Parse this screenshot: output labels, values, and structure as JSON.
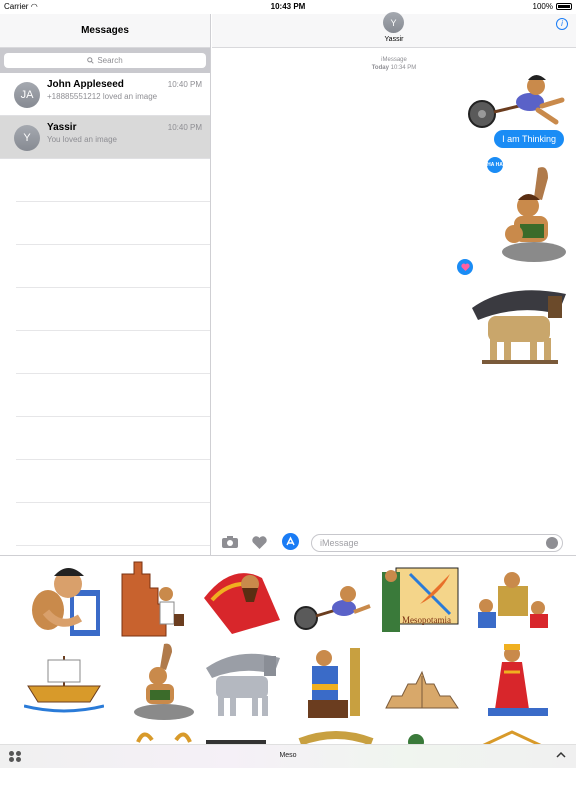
{
  "status_bar": {
    "carrier": "Carrier",
    "time": "10:43 PM",
    "battery": "100%"
  },
  "sidebar": {
    "title": "Messages",
    "search_placeholder": "Search",
    "conversations": [
      {
        "initials": "JA",
        "name": "John Appleseed",
        "time": "10:40 PM",
        "snippet": "+18885551212 loved an image"
      },
      {
        "initials": "Y",
        "name": "Yassir",
        "time": "10:40 PM",
        "snippet": "You loved an image"
      }
    ]
  },
  "chat": {
    "contact_initial": "Y",
    "contact_name": "Yassir",
    "service": "iMessage",
    "day": "Today",
    "timestamp": "10:34 PM",
    "sent_text": "I am Thinking",
    "tapback_haha": "HA HA",
    "input_placeholder": "iMessage"
  },
  "sticker_app": {
    "name": "Meso",
    "sticker_caption": "Mesopotamia",
    "stickers": [
      "man-with-jar-sticker",
      "brick-builder-sticker",
      "king-red-robe-sticker",
      "man-with-wheel-sticker",
      "mesopotamia-map-sticker",
      "family-sitting-sticker",
      "boat-sticker",
      "man-with-club-sticker",
      "lamassu-sticker",
      "harp-player-sticker",
      "ziggurat-sticker",
      "queen-red-dress-sticker"
    ]
  },
  "colors": {
    "accent": "#1a8cf5",
    "selected_row": "#d9d9d9"
  }
}
